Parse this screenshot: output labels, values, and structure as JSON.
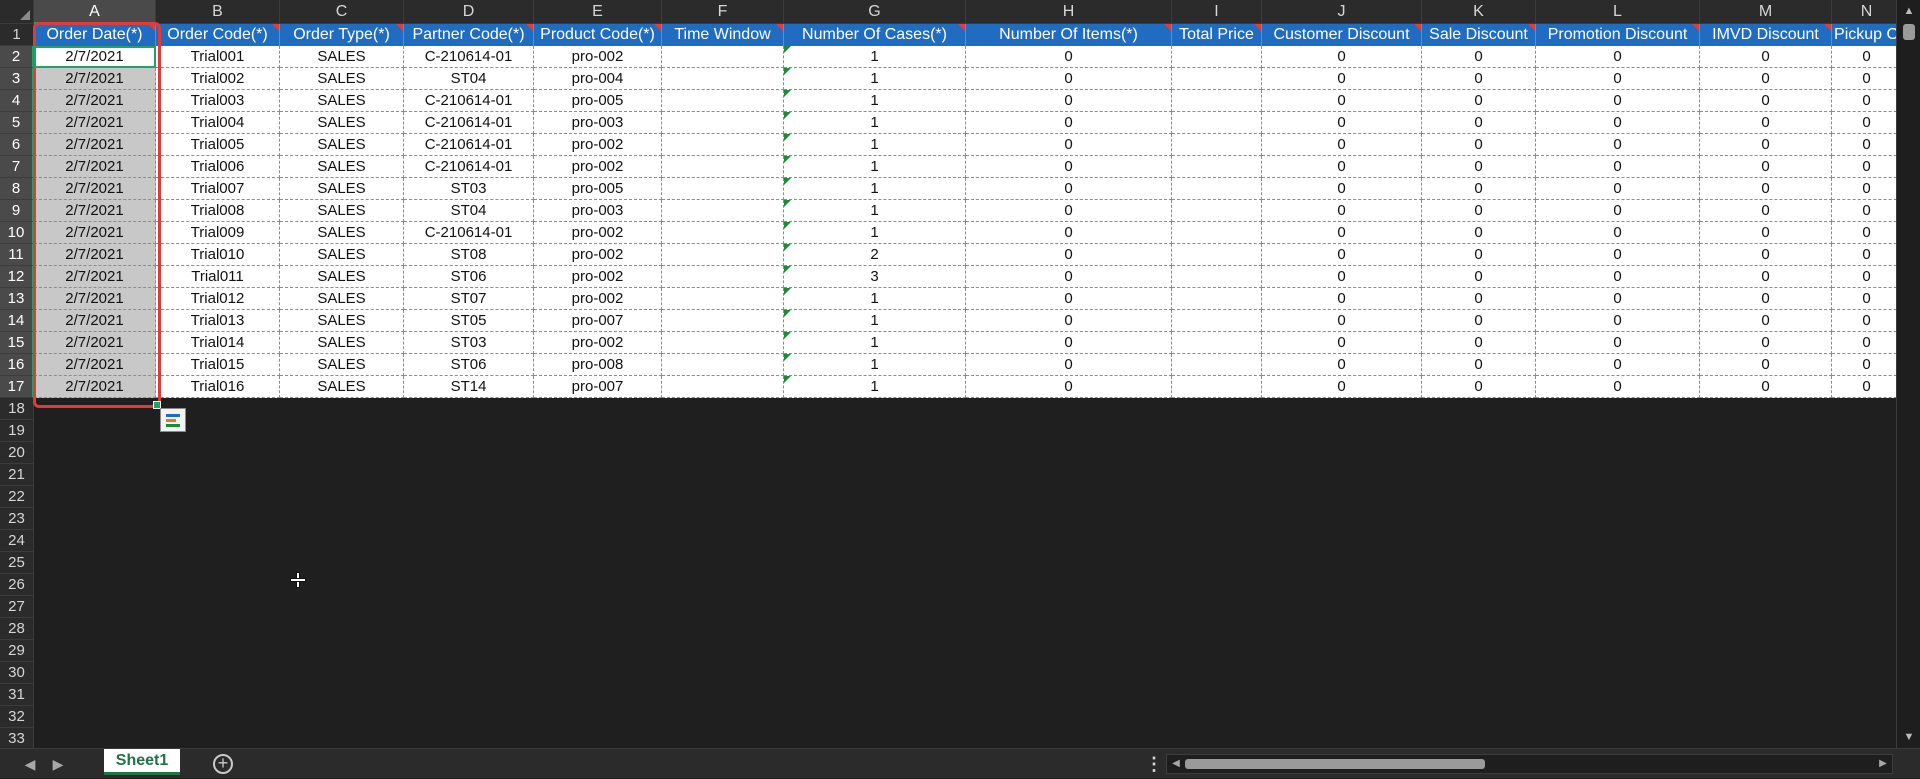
{
  "columns": [
    "A",
    "B",
    "C",
    "D",
    "E",
    "F",
    "G",
    "H",
    "I",
    "J",
    "K",
    "L",
    "M",
    "N"
  ],
  "header_row": [
    {
      "label": "Order Date(*)",
      "comment": true
    },
    {
      "label": "Order Code(*)",
      "comment": true
    },
    {
      "label": "Order Type(*)",
      "comment": true
    },
    {
      "label": "Partner Code(*)",
      "comment": true
    },
    {
      "label": "Product Code(*)",
      "comment": true
    },
    {
      "label": "Time Window",
      "comment": true
    },
    {
      "label": "Number Of Cases(*)",
      "comment": true
    },
    {
      "label": "Number Of Items(*)",
      "comment": true
    },
    {
      "label": "Total Price",
      "comment": true
    },
    {
      "label": "Customer Discount",
      "comment": true
    },
    {
      "label": "Sale Discount",
      "comment": true
    },
    {
      "label": "Promotion Discount",
      "comment": true
    },
    {
      "label": "IMVD Discount",
      "comment": true
    },
    {
      "label": "Pickup O",
      "comment": false
    }
  ],
  "rows": [
    [
      "2/7/2021",
      "Trial001",
      "SALES",
      "C-210614-01",
      "pro-002",
      "",
      "1",
      "0",
      "",
      "0",
      "0",
      "0",
      "0",
      "0"
    ],
    [
      "2/7/2021",
      "Trial002",
      "SALES",
      "ST04",
      "pro-004",
      "",
      "1",
      "0",
      "",
      "0",
      "0",
      "0",
      "0",
      "0"
    ],
    [
      "2/7/2021",
      "Trial003",
      "SALES",
      "C-210614-01",
      "pro-005",
      "",
      "1",
      "0",
      "",
      "0",
      "0",
      "0",
      "0",
      "0"
    ],
    [
      "2/7/2021",
      "Trial004",
      "SALES",
      "C-210614-01",
      "pro-003",
      "",
      "1",
      "0",
      "",
      "0",
      "0",
      "0",
      "0",
      "0"
    ],
    [
      "2/7/2021",
      "Trial005",
      "SALES",
      "C-210614-01",
      "pro-002",
      "",
      "1",
      "0",
      "",
      "0",
      "0",
      "0",
      "0",
      "0"
    ],
    [
      "2/7/2021",
      "Trial006",
      "SALES",
      "C-210614-01",
      "pro-002",
      "",
      "1",
      "0",
      "",
      "0",
      "0",
      "0",
      "0",
      "0"
    ],
    [
      "2/7/2021",
      "Trial007",
      "SALES",
      "ST03",
      "pro-005",
      "",
      "1",
      "0",
      "",
      "0",
      "0",
      "0",
      "0",
      "0"
    ],
    [
      "2/7/2021",
      "Trial008",
      "SALES",
      "ST04",
      "pro-003",
      "",
      "1",
      "0",
      "",
      "0",
      "0",
      "0",
      "0",
      "0"
    ],
    [
      "2/7/2021",
      "Trial009",
      "SALES",
      "C-210614-01",
      "pro-002",
      "",
      "1",
      "0",
      "",
      "0",
      "0",
      "0",
      "0",
      "0"
    ],
    [
      "2/7/2021",
      "Trial010",
      "SALES",
      "ST08",
      "pro-002",
      "",
      "2",
      "0",
      "",
      "0",
      "0",
      "0",
      "0",
      "0"
    ],
    [
      "2/7/2021",
      "Trial011",
      "SALES",
      "ST06",
      "pro-002",
      "",
      "3",
      "0",
      "",
      "0",
      "0",
      "0",
      "0",
      "0"
    ],
    [
      "2/7/2021",
      "Trial012",
      "SALES",
      "ST07",
      "pro-002",
      "",
      "1",
      "0",
      "",
      "0",
      "0",
      "0",
      "0",
      "0"
    ],
    [
      "2/7/2021",
      "Trial013",
      "SALES",
      "ST05",
      "pro-007",
      "",
      "1",
      "0",
      "",
      "0",
      "0",
      "0",
      "0",
      "0"
    ],
    [
      "2/7/2021",
      "Trial014",
      "SALES",
      "ST03",
      "pro-002",
      "",
      "1",
      "0",
      "",
      "0",
      "0",
      "0",
      "0",
      "0"
    ],
    [
      "2/7/2021",
      "Trial015",
      "SALES",
      "ST06",
      "pro-008",
      "",
      "1",
      "0",
      "",
      "0",
      "0",
      "0",
      "0",
      "0"
    ],
    [
      "2/7/2021",
      "Trial016",
      "SALES",
      "ST14",
      "pro-007",
      "",
      "1",
      "0",
      "",
      "0",
      "0",
      "0",
      "0",
      "0"
    ]
  ],
  "row_numbers": [
    "1",
    "2",
    "3",
    "4",
    "5",
    "6",
    "7",
    "8",
    "9",
    "10",
    "11",
    "12",
    "13",
    "14",
    "15",
    "16",
    "17",
    "18",
    "19",
    "20",
    "21",
    "22",
    "23",
    "24",
    "25",
    "26",
    "27",
    "28",
    "29",
    "30",
    "31",
    "32",
    "33"
  ],
  "selection": {
    "column": "A",
    "active_row": "2",
    "selected_rows": "2-17"
  },
  "sheet_tabs": [
    "Sheet1"
  ],
  "colors": {
    "header_blue": "#1f6cc0",
    "selection_red": "#e03a3a",
    "excel_green": "#217346",
    "selected_gray": "#c8c8c8"
  },
  "icons": {
    "add_sheet": "plus-circle-icon",
    "nav_prev": "triangle-left-icon",
    "nav_next": "triangle-right-icon",
    "quick_analysis": "quick-analysis-icon",
    "cursor": "move-cursor-icon",
    "more": "vertical-dots-icon"
  }
}
